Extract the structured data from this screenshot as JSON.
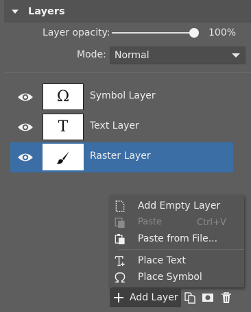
{
  "panel": {
    "title": "Layers"
  },
  "opacity": {
    "label": "Layer opacity:",
    "value": "100%",
    "level_percent": 100
  },
  "mode": {
    "label": "Mode:",
    "value": "Normal"
  },
  "layers": [
    {
      "name": "Symbol Layer",
      "thumb_glyph": "Ω",
      "visible": true,
      "selected": false
    },
    {
      "name": "Text Layer",
      "thumb_glyph": "T",
      "visible": true,
      "selected": false
    },
    {
      "name": "Raster Layer",
      "thumb_glyph": "brush",
      "visible": true,
      "selected": true
    }
  ],
  "menu": {
    "items": [
      {
        "label": "Add Empty Layer",
        "icon": "new-layer-icon",
        "enabled": true
      },
      {
        "label": "Paste",
        "shortcut": "Ctrl+V",
        "icon": "paste-icon",
        "enabled": false
      },
      {
        "label": "Paste from File...",
        "icon": "paste-from-file-icon",
        "enabled": true
      },
      {
        "label": "Place Text",
        "icon": "text-icon",
        "enabled": true
      },
      {
        "label": "Place Symbol",
        "icon": "omega-icon",
        "enabled": true
      }
    ]
  },
  "bottombar": {
    "add_label": "Add Layer"
  },
  "colors": {
    "background": "#5e5e5e",
    "selection": "#3a6ea5",
    "menu": "#555555"
  }
}
